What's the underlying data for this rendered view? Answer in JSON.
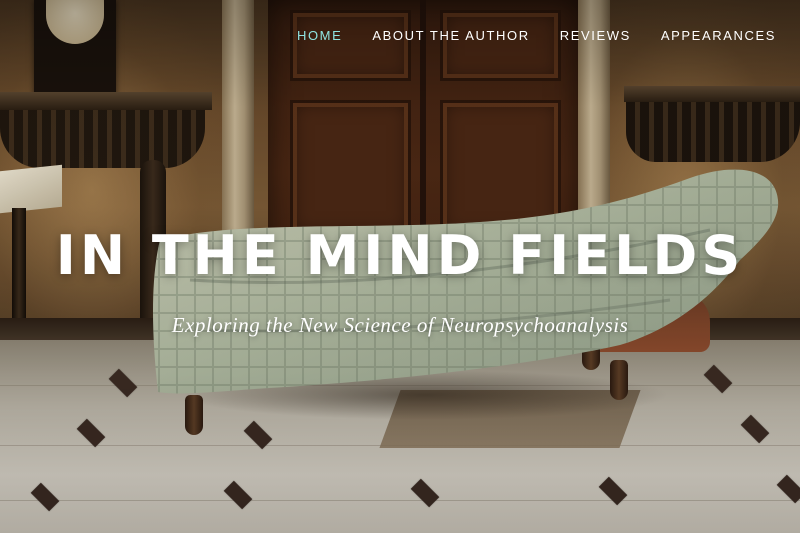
{
  "nav": {
    "items": [
      {
        "label": "HOME",
        "active": true
      },
      {
        "label": "ABOUT THE AUTHOR",
        "active": false
      },
      {
        "label": "REVIEWS",
        "active": false
      },
      {
        "label": "APPEARANCES",
        "active": false
      }
    ],
    "active_color": "#8fe3e0"
  },
  "hero": {
    "title": "IN THE MIND FIELDS",
    "subtitle": "Exploring the New Science of Neuropsychoanalysis",
    "background_image": "covered-psychoanalysis-couch-in-room"
  }
}
